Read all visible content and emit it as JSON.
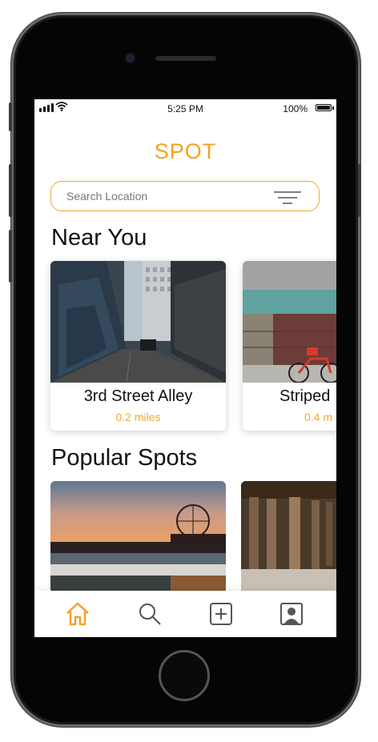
{
  "status_bar": {
    "time": "5:25 PM",
    "battery": "100%"
  },
  "app": {
    "title": "SPOT"
  },
  "search": {
    "placeholder": "Search Location"
  },
  "sections": {
    "near_you": {
      "title": "Near You",
      "cards": [
        {
          "name": "3rd Street Alley",
          "distance": "0.2 miles"
        },
        {
          "name": "Striped",
          "distance": "0.4 m"
        }
      ]
    },
    "popular": {
      "title": "Popular Spots"
    }
  },
  "tabs": [
    "home-icon",
    "search-icon",
    "add-icon",
    "profile-icon"
  ],
  "colors": {
    "accent": "#f5a31a",
    "text": "#111111"
  }
}
